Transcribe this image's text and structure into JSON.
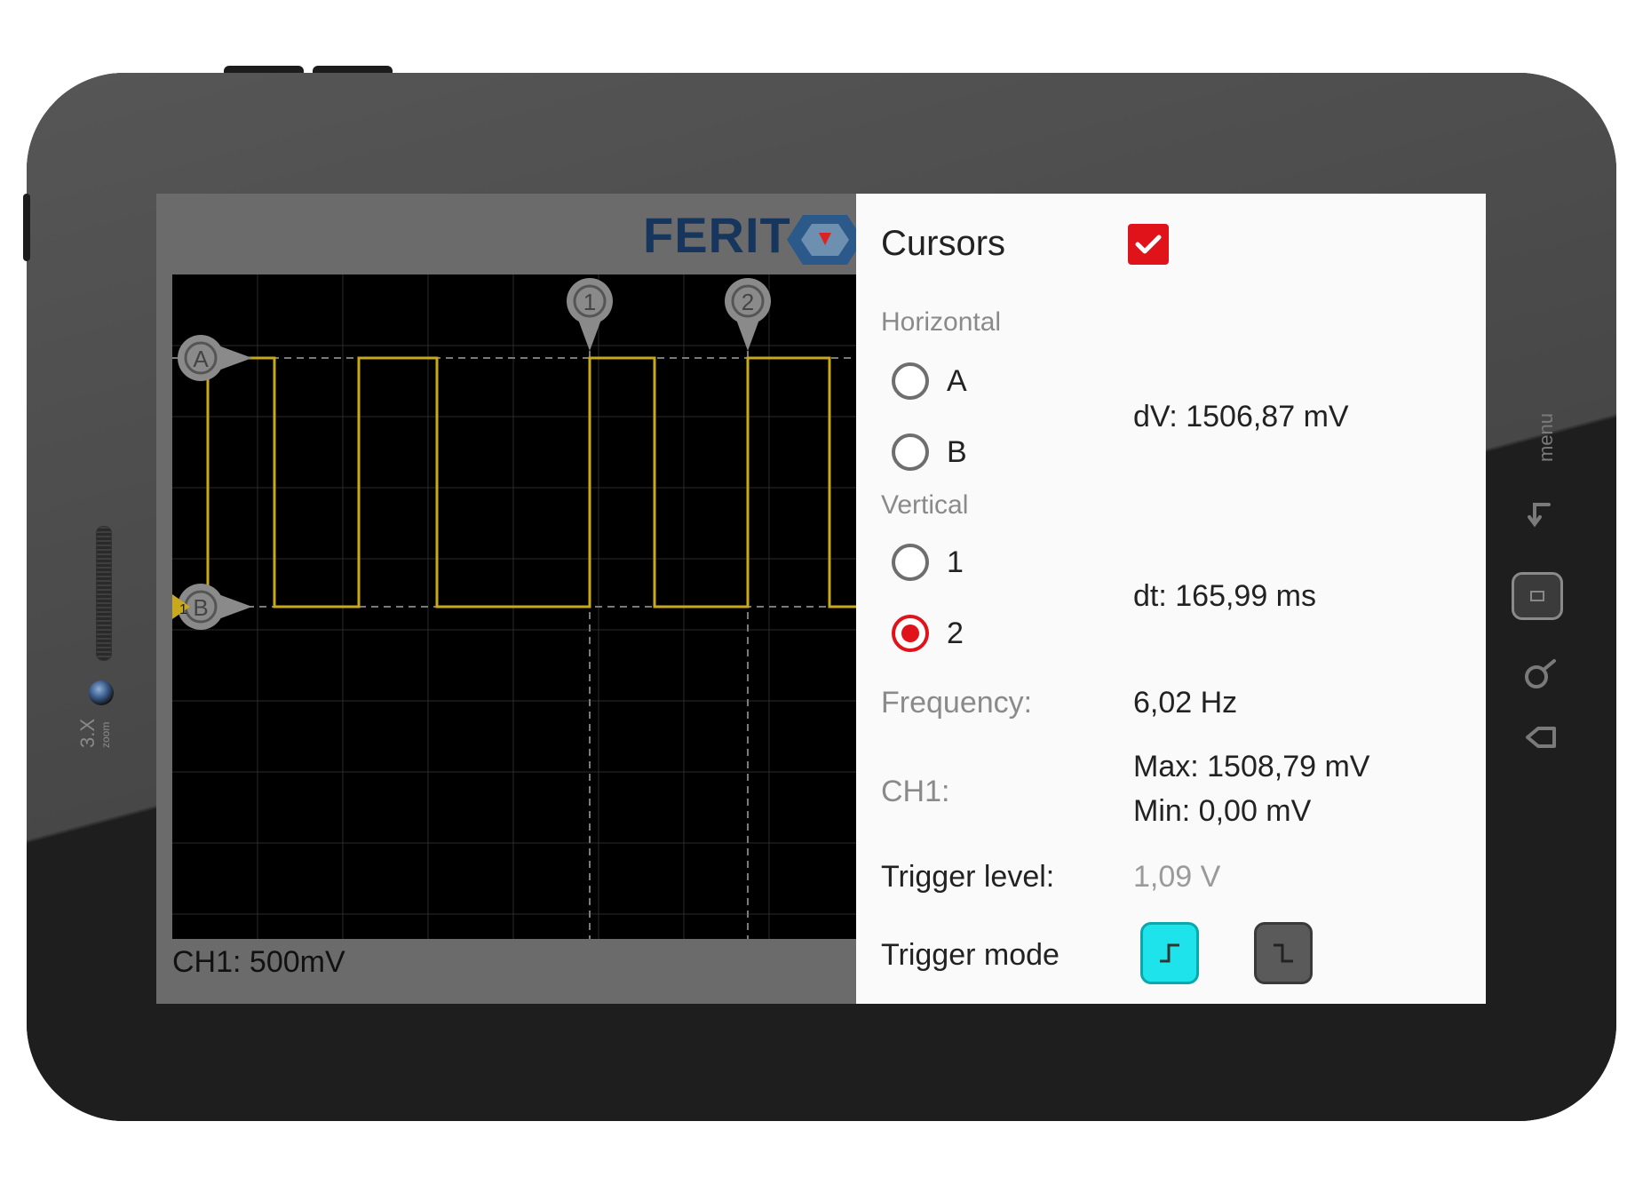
{
  "device": {
    "zoom_label": "3.X",
    "zoom_sub": "zoom",
    "menu_label": "menu"
  },
  "scope": {
    "brand": "FERIT",
    "channel_scale": "CH1: 500mV",
    "markers": {
      "a": "A",
      "b": "B",
      "one": "1",
      "two": "2",
      "ch": "1"
    },
    "trace_color": "#c8a81c"
  },
  "cursors": {
    "title": "Cursors",
    "enabled": true,
    "horizontal_label": "Horizontal",
    "horizontal_options": [
      "A",
      "B"
    ],
    "vertical_label": "Vertical",
    "vertical_options": [
      "1",
      "2"
    ],
    "vertical_selected": "2",
    "dv": "dV: 1506,87 mV",
    "dt": "dt: 165,99 ms",
    "frequency_label": "Frequency:",
    "frequency_value": "6,02 Hz",
    "ch_label": "CH1:",
    "ch_max": "Max: 1508,79 mV",
    "ch_min": "Min: 0,00 mV",
    "trigger_level_label": "Trigger level:",
    "trigger_level_value": "1,09 V",
    "trigger_mode_label": "Trigger mode",
    "trigger_mode_selected": "rising",
    "accent_color": "#e0121a",
    "trigger_active_color": "#1fe3ea"
  }
}
